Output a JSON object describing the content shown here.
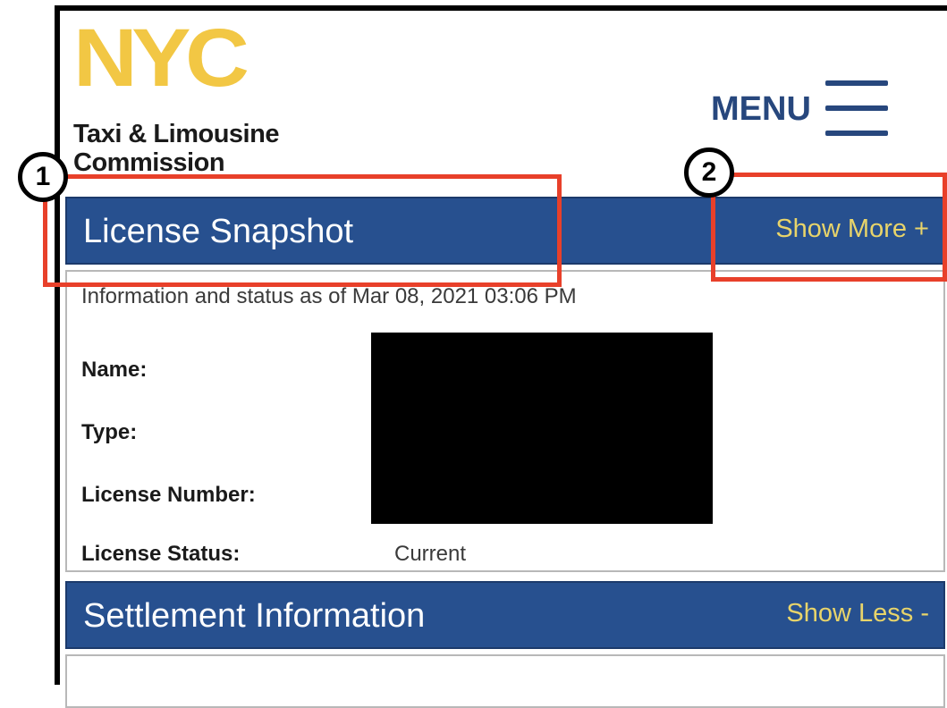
{
  "header": {
    "logo": {
      "mark": "NYC",
      "line1": "Taxi & Limousine",
      "line2": "Commission"
    },
    "menu_label": "MENU"
  },
  "license_snapshot": {
    "title": "License Snapshot",
    "toggle_label": "Show More +",
    "status_line": "Information and status as of  Mar 08, 2021 03:06 PM",
    "fields": {
      "name_label": "Name:",
      "type_label": "Type:",
      "license_number_label": "License Number:",
      "license_status_label": "License Status:",
      "license_status_value": "Current"
    }
  },
  "settlement": {
    "title": "Settlement Information",
    "toggle_label": "Show Less -"
  },
  "callouts": {
    "one": "1",
    "two": "2",
    "color": "#e8402a"
  },
  "colors": {
    "header_bar": "#27508f",
    "toggle_text": "#e8d46a",
    "logo_yellow": "#f2c744",
    "menu_blue": "#27477d"
  }
}
